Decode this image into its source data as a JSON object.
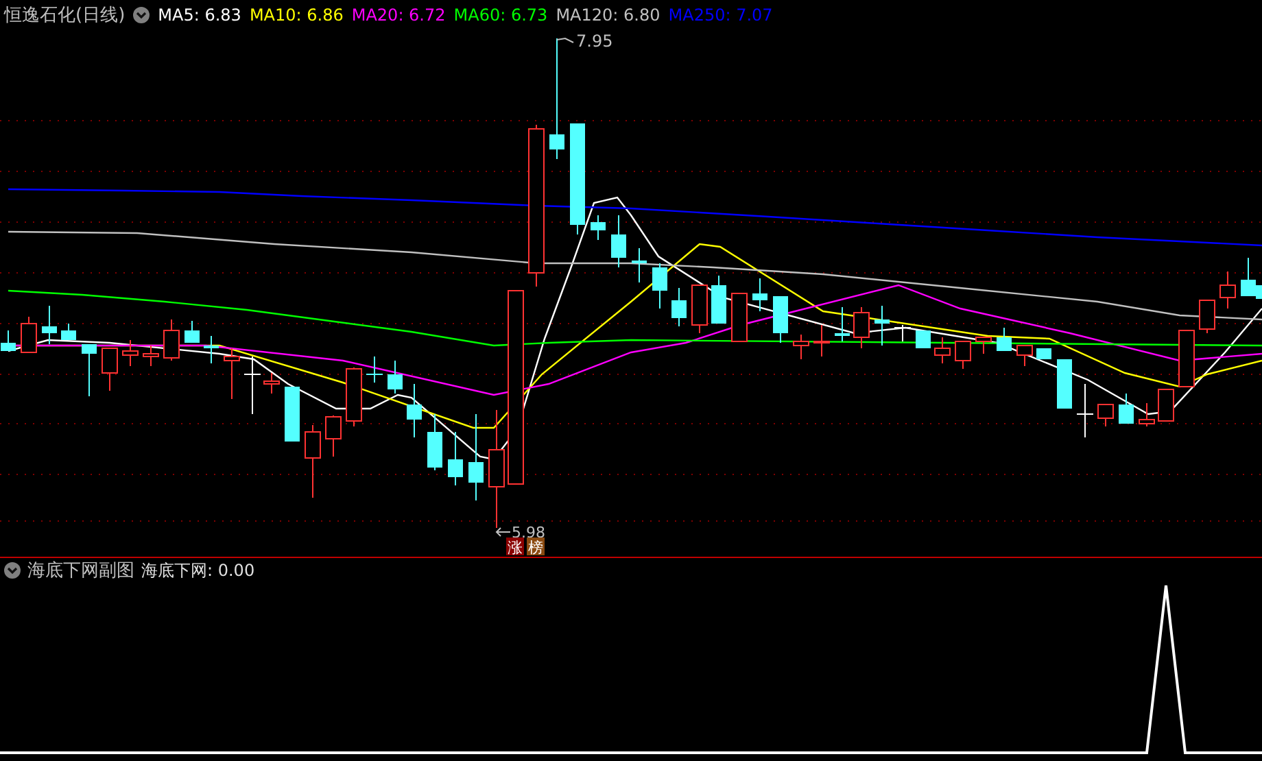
{
  "main_chart": {
    "title": "恒逸石化(日线)",
    "moving_averages": [
      {
        "text": "MA5: 6.83",
        "color": "#ffffff"
      },
      {
        "text": "MA10: 6.86",
        "color": "#ffff00"
      },
      {
        "text": "MA20: 6.72",
        "color": "#ff00ff"
      },
      {
        "text": "MA60: 6.73",
        "color": "#00ff00"
      },
      {
        "text": "MA120: 6.80",
        "color": "#c0c0c0"
      },
      {
        "text": "MA250: 7.07",
        "color": "#0000ff"
      }
    ],
    "high_label": "7.95",
    "low_label": "5.98",
    "badges": [
      {
        "text": "涨",
        "color": "#8b0000"
      },
      {
        "text": "榜",
        "color": "#8b4a10"
      }
    ]
  },
  "sub_chart": {
    "title": "海底下网副图",
    "indicator": "海底下网: 0.00"
  }
}
